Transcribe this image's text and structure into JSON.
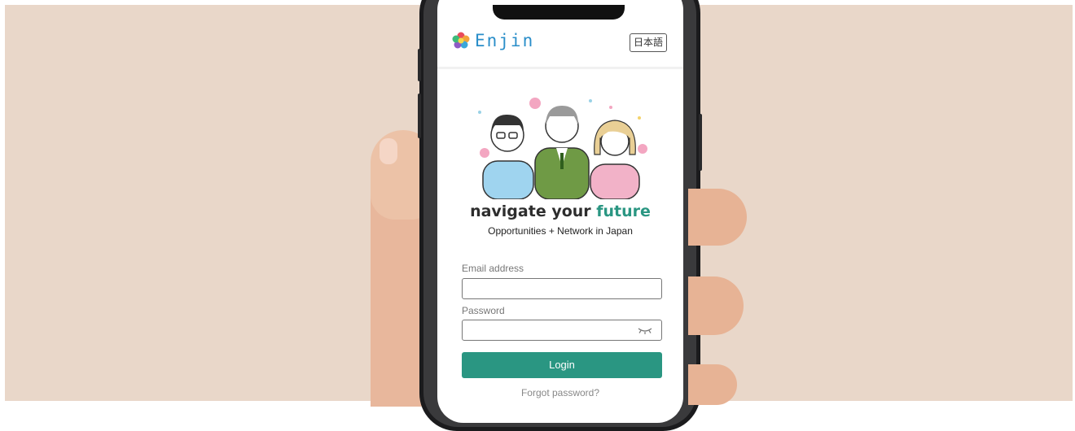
{
  "header": {
    "logo_text": "Enjin",
    "language_button": "日本語"
  },
  "hero": {
    "headline_prefix": "navigate your ",
    "headline_accent": "future",
    "tagline": "Opportunities + Network in Japan"
  },
  "form": {
    "email_label": "Email address",
    "email_value": "",
    "password_label": "Password",
    "password_value": "",
    "password_toggle_icon": "eye-closed-icon",
    "login_label": "Login",
    "forgot_label": "Forgot password?"
  },
  "colors": {
    "accent": "#2a9682",
    "logo_blue": "#2a8ec9",
    "background": "#e9d7c9"
  }
}
